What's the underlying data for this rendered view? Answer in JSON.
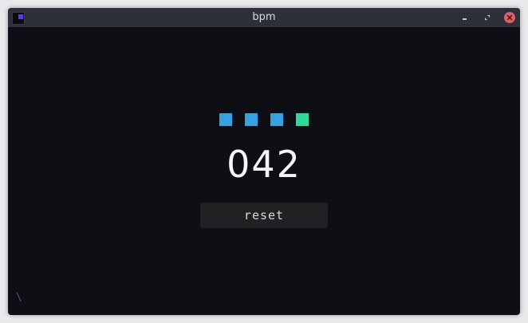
{
  "window": {
    "title": "bpm",
    "controls": {
      "minimize_icon": "minimize-icon",
      "maximize_icon": "maximize-icon",
      "close_icon": "close-icon"
    }
  },
  "beat_indicators": {
    "colors": [
      "#35a3e3",
      "#35a3e3",
      "#35a3e3",
      "#2ed99a"
    ],
    "active_index": 3
  },
  "display": {
    "bpm": "042"
  },
  "reset_button": {
    "label": "reset"
  },
  "status": {
    "spinner": "\\"
  },
  "colors": {
    "background": "#0e0f15",
    "titlebar": "#2d3038",
    "beat_idle": "#35a3e3",
    "beat_active": "#2ed99a",
    "close_button": "#e35d6a"
  }
}
